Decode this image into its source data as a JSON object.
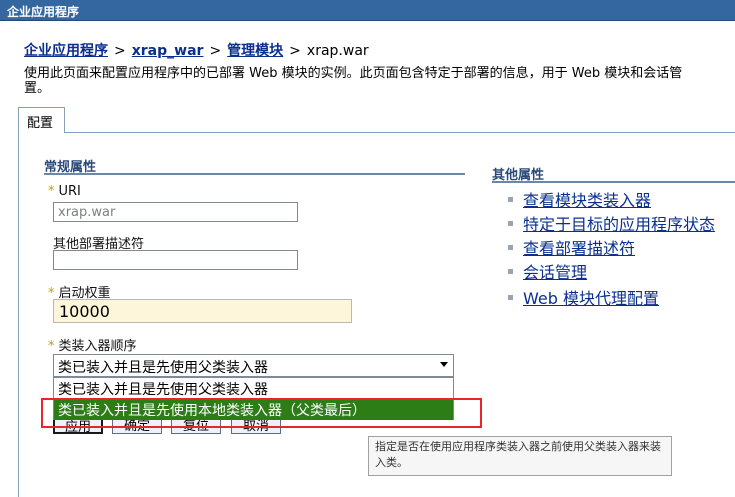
{
  "window": {
    "title": "企业应用程序"
  },
  "breadcrumb": {
    "items": [
      "企业应用程序",
      "xrap_war",
      "管理模块"
    ],
    "separator": ">",
    "current": "xrap.war"
  },
  "description": "使用此页面来配置应用程序中的已部署 Web 模块的实例。此页面包含特定于部署的信息，用于 Web 模块和会话管\n置。",
  "tabs": [
    {
      "label": "配置"
    }
  ],
  "general": {
    "heading": "常规属性",
    "uri": {
      "label": "URI",
      "required": "*",
      "value": "xrap.war"
    },
    "deploy_desc": {
      "label": "其他部署描述符",
      "value": ""
    },
    "start_weight": {
      "label": "启动权重",
      "required": "*",
      "value": "10000"
    },
    "classloader": {
      "label": "类装入器顺序",
      "required": "*",
      "selected": "类已装入并且是先使用父类装入器",
      "options": [
        "类已装入并且是先使用父类装入器",
        "类已装入并且是先使用本地类装入器（父类最后）"
      ]
    }
  },
  "buttons": {
    "apply": "应用",
    "ok": "确定",
    "reset": "复位",
    "cancel": "取消"
  },
  "tooltip": "指定是否在使用应用程序类装入器之前使用父类装入器来装入类。",
  "other": {
    "heading": "其他属性",
    "links": [
      "查看模块类装入器",
      "特定于目标的应用程序状态",
      "查看部署描述符",
      "会话管理",
      "Web 模块代理配置"
    ]
  },
  "colors": {
    "title_bar": "#3466a0",
    "selected_option": "#2d7d17",
    "highlight_box": "#e8242c",
    "link": "#0a2f8f"
  }
}
